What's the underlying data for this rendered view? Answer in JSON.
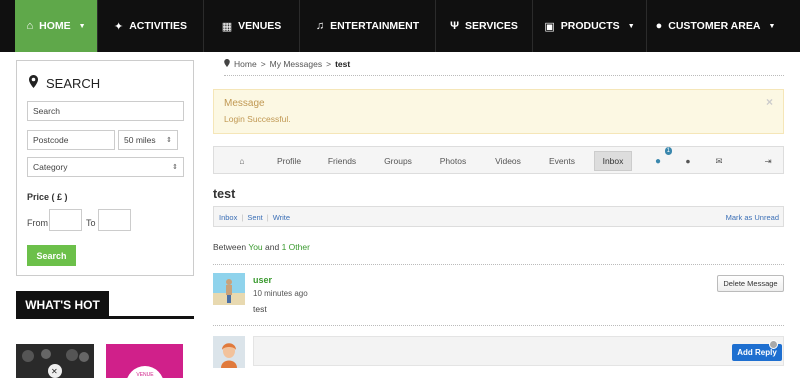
{
  "nav": {
    "items": [
      {
        "label": "HOME",
        "icon": "home-icon",
        "caret": "⌄"
      },
      {
        "label": "ACTIVITIES",
        "icon": "compass-icon"
      },
      {
        "label": "VENUES",
        "icon": "building-icon"
      },
      {
        "label": "ENTERTAINMENT",
        "icon": "music-icon"
      },
      {
        "label": "SERVICES",
        "icon": "cutlery-icon"
      },
      {
        "label": "PRODUCTS",
        "icon": "gift-icon",
        "caret": "⌄"
      },
      {
        "label": "CUSTOMER AREA",
        "icon": "user-icon",
        "caret": "⌄"
      }
    ],
    "active_color": "#5fa84a"
  },
  "search": {
    "title": "SEARCH",
    "keyword_placeholder": "Search",
    "postcode_placeholder": "Postcode",
    "distance_value": "50 miles",
    "category_value": "Category",
    "price_label": "Price ( £ )",
    "from_label": "From",
    "to_label": "To",
    "button_label": "Search",
    "button_color": "#6cc04a"
  },
  "whats_hot": {
    "title": "WHAT'S HOT",
    "venue_tag": "VENUE"
  },
  "breadcrumb": {
    "home": "Home",
    "messages": "My Messages",
    "current": "test",
    "separator": ">"
  },
  "alert": {
    "title": "Message",
    "message": "Login Successful.",
    "close": "×"
  },
  "tabs": {
    "items": [
      "Profile",
      "Friends",
      "Groups",
      "Photos",
      "Videos",
      "Events",
      "Inbox"
    ],
    "active": "Inbox",
    "notification_count": "1"
  },
  "thread": {
    "title": "test",
    "links": [
      "Inbox",
      "Sent",
      "Write"
    ],
    "mark_unread": "Mark as Unread",
    "between_prefix": "Between",
    "between_you": "You",
    "between_and": "and",
    "between_other": "1 Other"
  },
  "message": {
    "user": "user",
    "time": "10 minutes ago",
    "body": "test",
    "delete_label": "Delete Message"
  },
  "reply": {
    "button_label": "Add Reply",
    "button_color": "#1e6fd0"
  }
}
